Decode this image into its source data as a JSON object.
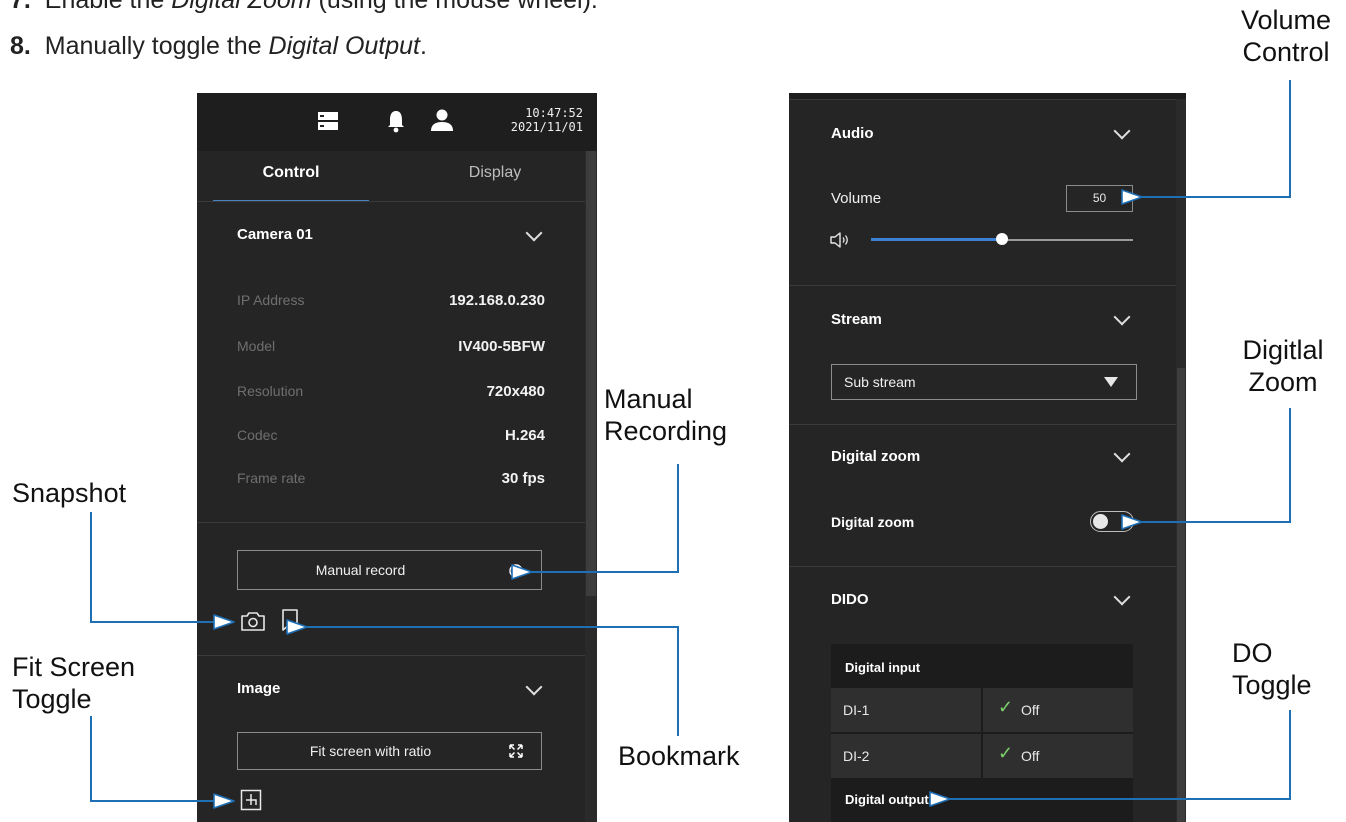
{
  "instructions": {
    "step7": {
      "number": "7.",
      "pre": "Enable the ",
      "em": "Digital Zoom",
      "post": " (using the mouse wheel)."
    },
    "step8": {
      "number": "8.",
      "pre": "Manually toggle the ",
      "em": "Digital Output",
      "post": "."
    }
  },
  "callouts": {
    "volume_line1": "Volume",
    "volume_line2": "Control",
    "zoom_line1": "Digitlal",
    "zoom_line2": "Zoom",
    "manual_line1": "Manual",
    "manual_line2": "Recording",
    "snapshot": "Snapshot",
    "fit_line1": "Fit Screen",
    "fit_line2": "Toggle",
    "bookmark": "Bookmark",
    "do_line1": "DO",
    "do_line2": "Toggle"
  },
  "left_panel": {
    "header": {
      "time": "10:47:52",
      "date": "2021/11/01",
      "icons": [
        "server-icon",
        "bell-icon",
        "user-icon"
      ]
    },
    "tabs": [
      {
        "label": "Control",
        "active": true
      },
      {
        "label": "Display",
        "active": false
      }
    ],
    "camera": {
      "title": "Camera 01",
      "rows": [
        {
          "label": "IP Address",
          "value": "192.168.0.230"
        },
        {
          "label": "Model",
          "value": "IV400-5BFW"
        },
        {
          "label": "Resolution",
          "value": "720x480"
        },
        {
          "label": "Codec",
          "value": "H.264"
        },
        {
          "label": "Frame rate",
          "value": "30 fps"
        }
      ]
    },
    "manual_record_label": "Manual record",
    "image_section": {
      "title": "Image",
      "fit_button_label": "Fit screen with ratio"
    }
  },
  "right_panel": {
    "audio": {
      "title": "Audio",
      "volume_label": "Volume",
      "volume_value": "50",
      "volume_level_percent": 50
    },
    "stream": {
      "title": "Stream",
      "selected": "Sub stream"
    },
    "digital_zoom": {
      "title": "Digital zoom",
      "toggle_label": "Digital zoom",
      "enabled": false
    },
    "dido": {
      "title": "DIDO",
      "input_header": "Digital input",
      "inputs": [
        {
          "name": "DI-1",
          "status": "Off"
        },
        {
          "name": "DI-2",
          "status": "Off"
        }
      ],
      "output_header": "Digital output"
    }
  },
  "colors": {
    "panel_bg": "#252526",
    "accent_blue": "#1f6fb5",
    "tab_underline": "#4a7fc1",
    "check_green": "#7bd16a"
  }
}
